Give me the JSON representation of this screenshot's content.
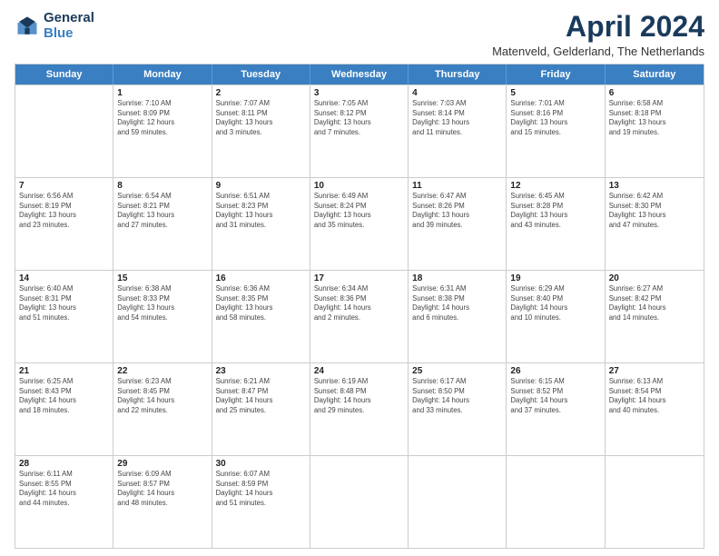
{
  "logo": {
    "general": "General",
    "blue": "Blue"
  },
  "header": {
    "month_year": "April 2024",
    "location": "Matenveld, Gelderland, The Netherlands"
  },
  "days_of_week": [
    "Sunday",
    "Monday",
    "Tuesday",
    "Wednesday",
    "Thursday",
    "Friday",
    "Saturday"
  ],
  "rows": [
    [
      {
        "day": "",
        "info": ""
      },
      {
        "day": "1",
        "info": "Sunrise: 7:10 AM\nSunset: 8:09 PM\nDaylight: 12 hours\nand 59 minutes."
      },
      {
        "day": "2",
        "info": "Sunrise: 7:07 AM\nSunset: 8:11 PM\nDaylight: 13 hours\nand 3 minutes."
      },
      {
        "day": "3",
        "info": "Sunrise: 7:05 AM\nSunset: 8:12 PM\nDaylight: 13 hours\nand 7 minutes."
      },
      {
        "day": "4",
        "info": "Sunrise: 7:03 AM\nSunset: 8:14 PM\nDaylight: 13 hours\nand 11 minutes."
      },
      {
        "day": "5",
        "info": "Sunrise: 7:01 AM\nSunset: 8:16 PM\nDaylight: 13 hours\nand 15 minutes."
      },
      {
        "day": "6",
        "info": "Sunrise: 6:58 AM\nSunset: 8:18 PM\nDaylight: 13 hours\nand 19 minutes."
      }
    ],
    [
      {
        "day": "7",
        "info": "Sunrise: 6:56 AM\nSunset: 8:19 PM\nDaylight: 13 hours\nand 23 minutes."
      },
      {
        "day": "8",
        "info": "Sunrise: 6:54 AM\nSunset: 8:21 PM\nDaylight: 13 hours\nand 27 minutes."
      },
      {
        "day": "9",
        "info": "Sunrise: 6:51 AM\nSunset: 8:23 PM\nDaylight: 13 hours\nand 31 minutes."
      },
      {
        "day": "10",
        "info": "Sunrise: 6:49 AM\nSunset: 8:24 PM\nDaylight: 13 hours\nand 35 minutes."
      },
      {
        "day": "11",
        "info": "Sunrise: 6:47 AM\nSunset: 8:26 PM\nDaylight: 13 hours\nand 39 minutes."
      },
      {
        "day": "12",
        "info": "Sunrise: 6:45 AM\nSunset: 8:28 PM\nDaylight: 13 hours\nand 43 minutes."
      },
      {
        "day": "13",
        "info": "Sunrise: 6:42 AM\nSunset: 8:30 PM\nDaylight: 13 hours\nand 47 minutes."
      }
    ],
    [
      {
        "day": "14",
        "info": "Sunrise: 6:40 AM\nSunset: 8:31 PM\nDaylight: 13 hours\nand 51 minutes."
      },
      {
        "day": "15",
        "info": "Sunrise: 6:38 AM\nSunset: 8:33 PM\nDaylight: 13 hours\nand 54 minutes."
      },
      {
        "day": "16",
        "info": "Sunrise: 6:36 AM\nSunset: 8:35 PM\nDaylight: 13 hours\nand 58 minutes."
      },
      {
        "day": "17",
        "info": "Sunrise: 6:34 AM\nSunset: 8:36 PM\nDaylight: 14 hours\nand 2 minutes."
      },
      {
        "day": "18",
        "info": "Sunrise: 6:31 AM\nSunset: 8:38 PM\nDaylight: 14 hours\nand 6 minutes."
      },
      {
        "day": "19",
        "info": "Sunrise: 6:29 AM\nSunset: 8:40 PM\nDaylight: 14 hours\nand 10 minutes."
      },
      {
        "day": "20",
        "info": "Sunrise: 6:27 AM\nSunset: 8:42 PM\nDaylight: 14 hours\nand 14 minutes."
      }
    ],
    [
      {
        "day": "21",
        "info": "Sunrise: 6:25 AM\nSunset: 8:43 PM\nDaylight: 14 hours\nand 18 minutes."
      },
      {
        "day": "22",
        "info": "Sunrise: 6:23 AM\nSunset: 8:45 PM\nDaylight: 14 hours\nand 22 minutes."
      },
      {
        "day": "23",
        "info": "Sunrise: 6:21 AM\nSunset: 8:47 PM\nDaylight: 14 hours\nand 25 minutes."
      },
      {
        "day": "24",
        "info": "Sunrise: 6:19 AM\nSunset: 8:48 PM\nDaylight: 14 hours\nand 29 minutes."
      },
      {
        "day": "25",
        "info": "Sunrise: 6:17 AM\nSunset: 8:50 PM\nDaylight: 14 hours\nand 33 minutes."
      },
      {
        "day": "26",
        "info": "Sunrise: 6:15 AM\nSunset: 8:52 PM\nDaylight: 14 hours\nand 37 minutes."
      },
      {
        "day": "27",
        "info": "Sunrise: 6:13 AM\nSunset: 8:54 PM\nDaylight: 14 hours\nand 40 minutes."
      }
    ],
    [
      {
        "day": "28",
        "info": "Sunrise: 6:11 AM\nSunset: 8:55 PM\nDaylight: 14 hours\nand 44 minutes."
      },
      {
        "day": "29",
        "info": "Sunrise: 6:09 AM\nSunset: 8:57 PM\nDaylight: 14 hours\nand 48 minutes."
      },
      {
        "day": "30",
        "info": "Sunrise: 6:07 AM\nSunset: 8:59 PM\nDaylight: 14 hours\nand 51 minutes."
      },
      {
        "day": "",
        "info": ""
      },
      {
        "day": "",
        "info": ""
      },
      {
        "day": "",
        "info": ""
      },
      {
        "day": "",
        "info": ""
      }
    ]
  ]
}
